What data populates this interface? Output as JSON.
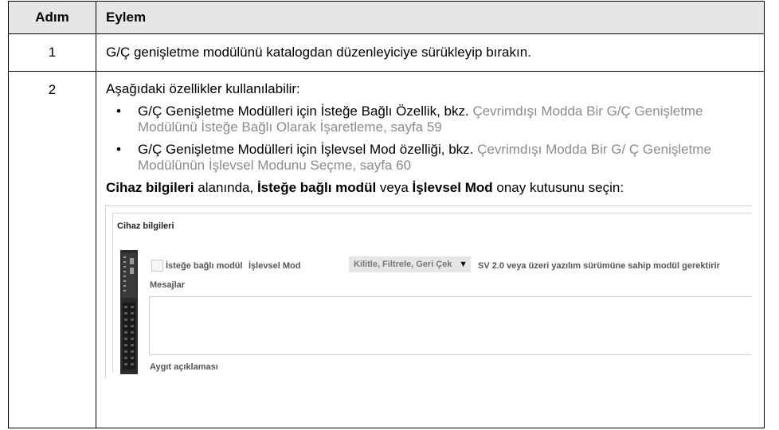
{
  "table": {
    "header": {
      "step": "Adım",
      "action": "Eylem"
    },
    "rows": [
      {
        "step": "1",
        "text": "G/Ç genişletme modülünü katalogdan düzenleyiciye sürükleyip bırakın."
      },
      {
        "step": "2",
        "intro": "Aşağıdaki özellikler kullanılabilir:",
        "bullets": [
          {
            "text": "G/Ç Genişletme Modülleri için İsteğe Bağlı Özellik, bkz.",
            "link": "Çevrimdışı Modda Bir G/Ç Genişletme Modülünü İsteğe Bağlı Olarak İşaretleme, sayfa 59"
          },
          {
            "text": "G/Ç Genişletme Modülleri için İşlevsel Mod özelliği, bkz.",
            "link": "Çevrimdışı Modda Bir G/ Ç Genişletme Modülünün İşlevsel Modunu Seçme, sayfa 60"
          }
        ],
        "instruction": {
          "b1": "Cihaz bilgileri",
          "t1": " alanında, ",
          "b2": "İsteğe bağlı modül",
          "t2": " veya ",
          "b3": "İşlevsel Mod",
          "t3": " onay kutusunu seçin:"
        }
      }
    ]
  },
  "screenshot": {
    "title": "Cihaz bilgileri",
    "optional_label": "İsteğe bağlı modül",
    "optional_checked": false,
    "mode_label": "İşlevsel Mod",
    "mode_value": "Kilitle, Filtrele, Geri Çek",
    "requirement_text": "SV 2.0 veya üzeri yazılım sürümüne sahip modül gerektirir",
    "messages_label": "Mesajlar",
    "description_label": "Aygıt açıklaması"
  },
  "colors": {
    "link": "#8b8b8b",
    "header_bg": "#e6e6e6"
  }
}
